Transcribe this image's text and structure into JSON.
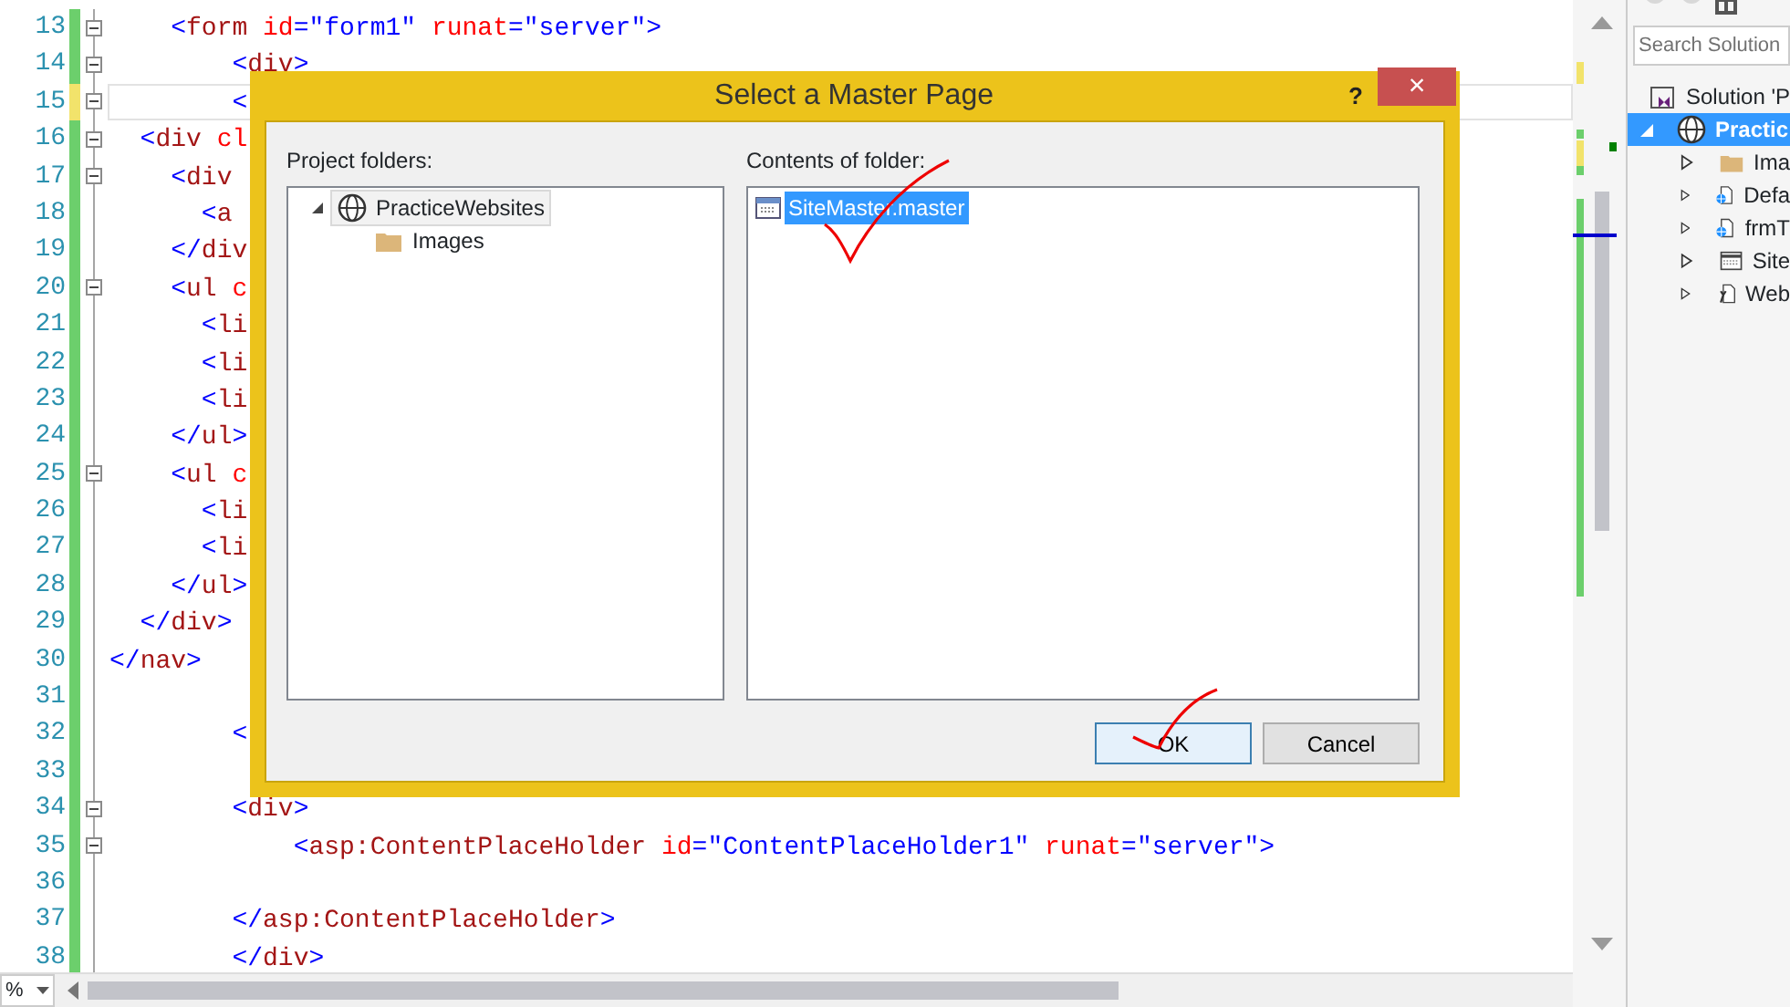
{
  "editor": {
    "lines": [
      {
        "number": "13",
        "modified": false,
        "fold": true,
        "current": false,
        "tokens": [
          {
            "kind": "punct",
            "text": "    <"
          },
          {
            "kind": "tag",
            "text": "form"
          },
          {
            "kind": "attr",
            "text": " id"
          },
          {
            "kind": "punct",
            "text": "="
          },
          {
            "kind": "value",
            "text": "\"form1\""
          },
          {
            "kind": "attr",
            "text": " runat"
          },
          {
            "kind": "punct",
            "text": "="
          },
          {
            "kind": "value",
            "text": "\"server\""
          },
          {
            "kind": "punct",
            "text": ">"
          }
        ]
      },
      {
        "number": "14",
        "modified": false,
        "fold": true,
        "current": false,
        "tokens": [
          {
            "kind": "punct",
            "text": "        <"
          },
          {
            "kind": "tag",
            "text": "div"
          },
          {
            "kind": "punct",
            "text": ">"
          }
        ]
      },
      {
        "number": "15",
        "modified": true,
        "fold": true,
        "current": true,
        "tokens": [
          {
            "kind": "punct",
            "text": "        <"
          }
        ]
      },
      {
        "number": "16",
        "modified": false,
        "fold": true,
        "current": false,
        "tokens": [
          {
            "kind": "punct",
            "text": "  <"
          },
          {
            "kind": "tag",
            "text": "div"
          },
          {
            "kind": "attr",
            "text": " cl"
          }
        ]
      },
      {
        "number": "17",
        "modified": false,
        "fold": true,
        "current": false,
        "tokens": [
          {
            "kind": "punct",
            "text": "    <"
          },
          {
            "kind": "tag",
            "text": "div"
          }
        ]
      },
      {
        "number": "18",
        "modified": false,
        "fold": false,
        "current": false,
        "tokens": [
          {
            "kind": "punct",
            "text": "      <"
          },
          {
            "kind": "tag",
            "text": "a"
          }
        ]
      },
      {
        "number": "19",
        "modified": false,
        "fold": false,
        "current": false,
        "tokens": [
          {
            "kind": "punct",
            "text": "    </"
          },
          {
            "kind": "tag",
            "text": "div"
          }
        ]
      },
      {
        "number": "20",
        "modified": false,
        "fold": true,
        "current": false,
        "tokens": [
          {
            "kind": "punct",
            "text": "    <"
          },
          {
            "kind": "tag",
            "text": "ul"
          },
          {
            "kind": "attr",
            "text": " c"
          }
        ]
      },
      {
        "number": "21",
        "modified": false,
        "fold": false,
        "current": false,
        "tokens": [
          {
            "kind": "punct",
            "text": "      <"
          },
          {
            "kind": "tag",
            "text": "li"
          }
        ]
      },
      {
        "number": "22",
        "modified": false,
        "fold": false,
        "current": false,
        "tokens": [
          {
            "kind": "punct",
            "text": "      <"
          },
          {
            "kind": "tag",
            "text": "li"
          }
        ]
      },
      {
        "number": "23",
        "modified": false,
        "fold": false,
        "current": false,
        "tokens": [
          {
            "kind": "punct",
            "text": "      <"
          },
          {
            "kind": "tag",
            "text": "li"
          }
        ]
      },
      {
        "number": "24",
        "modified": false,
        "fold": false,
        "current": false,
        "tokens": [
          {
            "kind": "punct",
            "text": "    </"
          },
          {
            "kind": "tag",
            "text": "ul"
          },
          {
            "kind": "punct",
            "text": ">"
          }
        ]
      },
      {
        "number": "25",
        "modified": false,
        "fold": true,
        "current": false,
        "tokens": [
          {
            "kind": "punct",
            "text": "    <"
          },
          {
            "kind": "tag",
            "text": "ul"
          },
          {
            "kind": "attr",
            "text": " c"
          }
        ]
      },
      {
        "number": "26",
        "modified": false,
        "fold": false,
        "current": false,
        "tokens": [
          {
            "kind": "punct",
            "text": "      <"
          },
          {
            "kind": "tag",
            "text": "li"
          }
        ]
      },
      {
        "number": "27",
        "modified": false,
        "fold": false,
        "current": false,
        "tokens": [
          {
            "kind": "punct",
            "text": "      <"
          },
          {
            "kind": "tag",
            "text": "li"
          }
        ]
      },
      {
        "number": "28",
        "modified": false,
        "fold": false,
        "current": false,
        "tokens": [
          {
            "kind": "punct",
            "text": "    </"
          },
          {
            "kind": "tag",
            "text": "ul"
          },
          {
            "kind": "punct",
            "text": ">"
          }
        ]
      },
      {
        "number": "29",
        "modified": false,
        "fold": false,
        "current": false,
        "tokens": [
          {
            "kind": "punct",
            "text": "  </"
          },
          {
            "kind": "tag",
            "text": "div"
          },
          {
            "kind": "punct",
            "text": ">"
          }
        ]
      },
      {
        "number": "30",
        "modified": false,
        "fold": false,
        "current": false,
        "tokens": [
          {
            "kind": "punct",
            "text": "</"
          },
          {
            "kind": "tag",
            "text": "nav"
          },
          {
            "kind": "punct",
            "text": ">"
          }
        ]
      },
      {
        "number": "31",
        "modified": false,
        "fold": false,
        "current": false
      },
      {
        "number": "32",
        "modified": false,
        "fold": false,
        "current": false,
        "tokens": [
          {
            "kind": "punct",
            "text": "        <"
          }
        ]
      },
      {
        "number": "33",
        "modified": false,
        "fold": false,
        "current": false
      },
      {
        "number": "34",
        "modified": false,
        "fold": true,
        "current": false,
        "tokens": [
          {
            "kind": "punct",
            "text": "        <"
          },
          {
            "kind": "tag",
            "text": "div"
          },
          {
            "kind": "punct",
            "text": ">"
          }
        ]
      },
      {
        "number": "35",
        "modified": false,
        "fold": true,
        "current": false,
        "tokens": [
          {
            "kind": "punct",
            "text": "            <"
          },
          {
            "kind": "tag",
            "text": "asp:ContentPlaceHolder"
          },
          {
            "kind": "attr",
            "text": " id"
          },
          {
            "kind": "punct",
            "text": "="
          },
          {
            "kind": "value",
            "text": "\"ContentPlaceHolder1\""
          },
          {
            "kind": "attr",
            "text": " runat"
          },
          {
            "kind": "punct",
            "text": "="
          },
          {
            "kind": "value",
            "text": "\"server\""
          },
          {
            "kind": "punct",
            "text": ">"
          }
        ]
      },
      {
        "number": "36",
        "modified": false,
        "fold": false,
        "current": false
      },
      {
        "number": "37",
        "modified": false,
        "fold": false,
        "current": false,
        "tokens": [
          {
            "kind": "punct",
            "text": "        </"
          },
          {
            "kind": "tag",
            "text": "asp:ContentPlaceHolder"
          },
          {
            "kind": "punct",
            "text": ">"
          }
        ]
      },
      {
        "number": "38",
        "modified": false,
        "fold": false,
        "current": false,
        "tokens": [
          {
            "kind": "punct",
            "text": "        </"
          },
          {
            "kind": "tag",
            "text": "div"
          },
          {
            "kind": "punct",
            "text": ">"
          }
        ]
      }
    ],
    "zoom": "%"
  },
  "dialog": {
    "title": "Select a Master Page",
    "help": "?",
    "close": "×",
    "project_label": "Project folders:",
    "folders": [
      {
        "label": "PracticeWebsites",
        "kind": "project",
        "expanded": true,
        "selected": true,
        "children": [
          {
            "label": "Images",
            "kind": "folder",
            "selected": false
          }
        ]
      }
    ],
    "contents_label": "Contents of folder:",
    "files": [
      {
        "label": "SiteMaster.master",
        "selected": true
      }
    ],
    "buttons": [
      {
        "label": "OK",
        "default": true
      },
      {
        "label": "Cancel",
        "default": false
      }
    ]
  },
  "solution_explorer": {
    "search": {
      "placeholder": "Search Solution"
    },
    "tree": [
      {
        "label": "Solution 'P",
        "kind": "solution",
        "selected": false,
        "children": [
          {
            "label": "Practic",
            "kind": "project",
            "selected": true,
            "expanded": true,
            "children": [
              {
                "label": "Ima",
                "kind": "folder",
                "selected": false,
                "expanded": false
              },
              {
                "label": "Defa",
                "kind": "webform",
                "selected": false,
                "expanded": false
              },
              {
                "label": "frmT",
                "kind": "webform",
                "selected": false,
                "expanded": false
              },
              {
                "label": "Site",
                "kind": "master",
                "selected": false,
                "expanded": false
              },
              {
                "label": "Web",
                "kind": "config",
                "selected": false,
                "expanded": false
              }
            ]
          }
        ]
      }
    ]
  }
}
